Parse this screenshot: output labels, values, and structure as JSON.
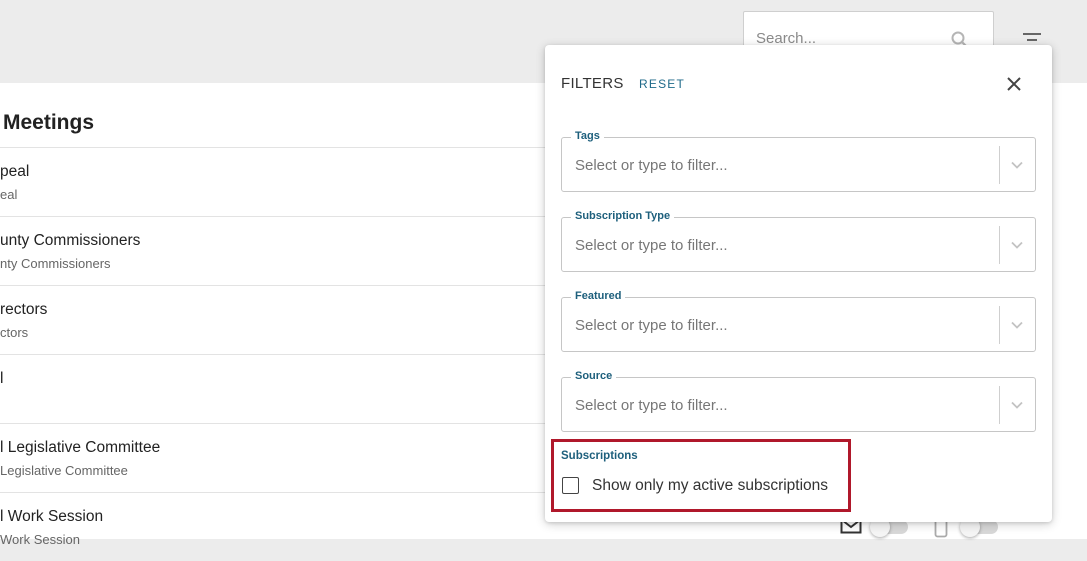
{
  "search": {
    "placeholder": "Search..."
  },
  "main": {
    "section_title": "Meetings",
    "items": [
      {
        "title": "peal",
        "subtitle": "eal"
      },
      {
        "title": "unty Commissioners",
        "subtitle": "nty Commissioners"
      },
      {
        "title": "rectors",
        "subtitle": "ctors"
      },
      {
        "title": "l",
        "subtitle": ""
      },
      {
        "title": "l Legislative Committee",
        "subtitle": "Legislative Committee"
      },
      {
        "title": "l Work Session",
        "subtitle": "Work Session"
      }
    ]
  },
  "filters_panel": {
    "title": "FILTERS",
    "reset_label": "RESET",
    "fields": [
      {
        "label": "Tags",
        "placeholder": "Select or type to filter..."
      },
      {
        "label": "Subscription Type",
        "placeholder": "Select or type to filter..."
      },
      {
        "label": "Featured",
        "placeholder": "Select or type to filter..."
      },
      {
        "label": "Source",
        "placeholder": "Select or type to filter..."
      }
    ],
    "subscriptions": {
      "heading": "Subscriptions",
      "checkbox_label": "Show only my active subscriptions",
      "checked": false
    }
  },
  "colors": {
    "accent": "#1d5f7c",
    "highlight": "#b0182b",
    "background": "#ececec"
  },
  "icons": [
    "search-icon",
    "filter-icon",
    "close-icon",
    "chevron-down-icon",
    "mail-icon",
    "phone-icon"
  ]
}
